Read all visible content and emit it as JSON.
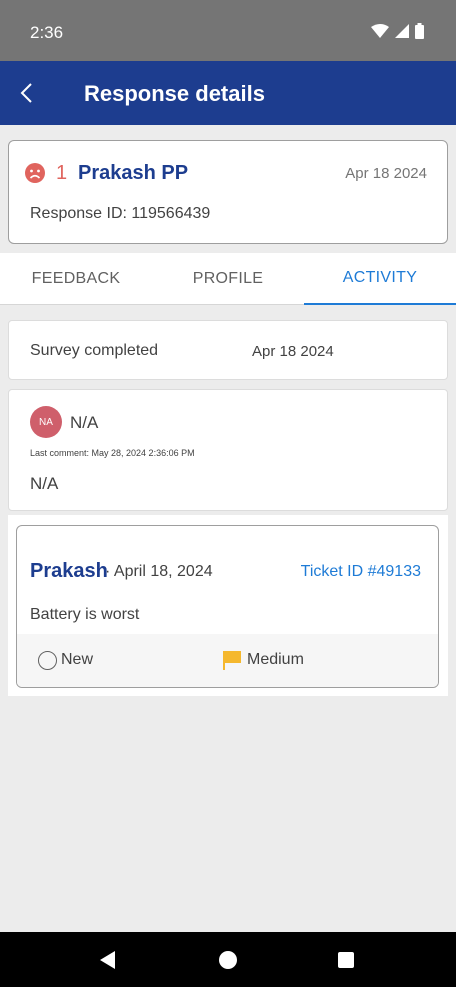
{
  "status_bar": {
    "time": "2:36"
  },
  "app_bar": {
    "title": "Response details",
    "back_icon": "chevron-left-icon"
  },
  "response": {
    "rating": "1",
    "customer_name": "Prakash PP",
    "date": "Apr 18 2024",
    "response_id": "Response ID: 119566439",
    "sentiment_color": "#e0645e"
  },
  "tabs": [
    {
      "label": "FEEDBACK",
      "active": false
    },
    {
      "label": "PROFILE",
      "active": false
    },
    {
      "label": "ACTIVITY",
      "active": true
    }
  ],
  "activity": {
    "survey": {
      "label": "Survey completed",
      "date": "Apr 18 2024"
    },
    "comment": {
      "avatar_initials": "NA",
      "user": "N/A",
      "last_comment": "Last comment: May 28, 2024 2:36:06 PM",
      "text": "N/A"
    },
    "ticket": {
      "name": "Prakash",
      "date": "· April 18, 2024",
      "ticket_id": "Ticket ID #49133",
      "description": "Battery is worst",
      "status": "New",
      "priority": "Medium",
      "priority_color": "#f5b82e"
    }
  },
  "colors": {
    "primary": "#1d3d8f",
    "accent": "#1e7bd6"
  }
}
